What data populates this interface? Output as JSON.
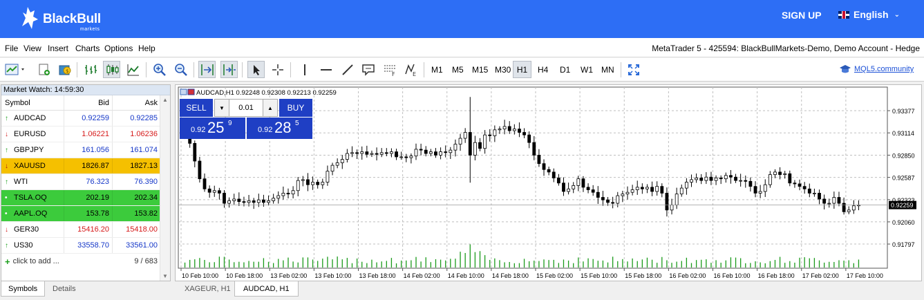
{
  "brand": {
    "name": "BlackBull",
    "sub": "markets",
    "signup": "SIGN UP",
    "language": "English"
  },
  "menu": [
    "File",
    "View",
    "Insert",
    "Charts",
    "Options",
    "Help"
  ],
  "account": "MetaTrader 5 - 425594: BlackBullMarkets-Demo, Demo Account - Hedge",
  "timeframes": [
    "M1",
    "M5",
    "M15",
    "M30",
    "H1",
    "H4",
    "D1",
    "W1",
    "MN"
  ],
  "active_timeframe": "H1",
  "mql5": "MQL5.community",
  "market_watch": {
    "title": "Market Watch: 14:59:30",
    "headers": {
      "symbol": "Symbol",
      "bid": "Bid",
      "ask": "Ask"
    },
    "rows": [
      {
        "symbol": "AUDCAD",
        "bid": "0.92259",
        "ask": "0.92285",
        "dir": "up",
        "style": "blue"
      },
      {
        "symbol": "EURUSD",
        "bid": "1.06221",
        "ask": "1.06236",
        "dir": "down",
        "style": "red"
      },
      {
        "symbol": "GBPJPY",
        "bid": "161.056",
        "ask": "161.074",
        "dir": "up",
        "style": "blue"
      },
      {
        "symbol": "XAUUSD",
        "bid": "1826.87",
        "ask": "1827.13",
        "dir": "down",
        "style": "gold"
      },
      {
        "symbol": "WTI",
        "bid": "76.323",
        "ask": "76.390",
        "dir": "up",
        "style": "blue"
      },
      {
        "symbol": "TSLA.OQ",
        "bid": "202.19",
        "ask": "202.34",
        "dir": "dot",
        "style": "green"
      },
      {
        "symbol": "AAPL.OQ",
        "bid": "153.78",
        "ask": "153.82",
        "dir": "dot",
        "style": "green"
      },
      {
        "symbol": "GER30",
        "bid": "15416.20",
        "ask": "15418.00",
        "dir": "down",
        "style": "red"
      },
      {
        "symbol": "US30",
        "bid": "33558.70",
        "ask": "33561.00",
        "dir": "up",
        "style": "blue"
      }
    ],
    "add_label": "click to add ...",
    "count": "9 / 683",
    "tabs": [
      "Symbols",
      "Details"
    ]
  },
  "chart": {
    "header": "AUDCAD,H1  0.92248 0.92308 0.92213 0.92259",
    "trade": {
      "sell": "SELL",
      "buy": "BUY",
      "lot": "0.01",
      "sell_small": "0.92",
      "sell_big": "25",
      "sell_sup": "9",
      "buy_small": "0.92",
      "buy_big": "28",
      "buy_sup": "5"
    },
    "current_price": "0.92259",
    "price_ticks": [
      "0.93377",
      "0.93114",
      "0.92850",
      "0.92587",
      "0.92323",
      "0.92060",
      "0.91797"
    ],
    "time_ticks": [
      "10 Feb 10:00",
      "10 Feb 18:00",
      "13 Feb 02:00",
      "13 Feb 10:00",
      "13 Feb 18:00",
      "14 Feb 02:00",
      "14 Feb 10:00",
      "14 Feb 18:00",
      "15 Feb 02:00",
      "15 Feb 10:00",
      "15 Feb 18:00",
      "16 Feb 02:00",
      "16 Feb 10:00",
      "16 Feb 18:00",
      "17 Feb 02:00",
      "17 Feb 10:00"
    ],
    "tabs": [
      "XAGEUR, H1",
      "AUDCAD, H1"
    ],
    "active_tab": "AUDCAD, H1"
  },
  "chart_data": {
    "type": "candlestick",
    "symbol": "AUDCAD",
    "timeframe": "H1",
    "ylim": [
      0.9165,
      0.9355
    ],
    "close": [
      0.931,
      0.9299,
      0.9278,
      0.9257,
      0.9245,
      0.9241,
      0.9243,
      0.924,
      0.9228,
      0.9231,
      0.9233,
      0.923,
      0.9229,
      0.9231,
      0.9229,
      0.9232,
      0.9229,
      0.9231,
      0.9234,
      0.9237,
      0.924,
      0.9239,
      0.9243,
      0.9255,
      0.9256,
      0.925,
      0.9253,
      0.925,
      0.9253,
      0.9266,
      0.9273,
      0.9276,
      0.928,
      0.9287,
      0.9288,
      0.9287,
      0.9289,
      0.9286,
      0.9287,
      0.9286,
      0.9288,
      0.9287,
      0.9289,
      0.9283,
      0.9283,
      0.9282,
      0.9284,
      0.9292,
      0.9291,
      0.9287,
      0.9289,
      0.9285,
      0.9289,
      0.9288,
      0.9291,
      0.9298,
      0.9305,
      0.9312,
      0.9285,
      0.93,
      0.9293,
      0.9309,
      0.9308,
      0.9315,
      0.9316,
      0.9319,
      0.9314,
      0.9316,
      0.9312,
      0.9309,
      0.93,
      0.9285,
      0.9275,
      0.9268,
      0.9265,
      0.9258,
      0.9252,
      0.9242,
      0.9245,
      0.9249,
      0.9257,
      0.9247,
      0.9244,
      0.9241,
      0.9235,
      0.9232,
      0.9229,
      0.9228,
      0.9237,
      0.9239,
      0.9241,
      0.9244,
      0.9247,
      0.9245,
      0.9247,
      0.9242,
      0.9248,
      0.924,
      0.922,
      0.9226,
      0.9239,
      0.9246,
      0.9253,
      0.9256,
      0.9258,
      0.9255,
      0.9259,
      0.9255,
      0.9258,
      0.9257,
      0.9261,
      0.9259,
      0.9255,
      0.9255,
      0.9254,
      0.9248,
      0.924,
      0.9242,
      0.925,
      0.9262,
      0.9265,
      0.9262,
      0.9263,
      0.9252,
      0.9251,
      0.9248,
      0.9245,
      0.924,
      0.924,
      0.9233,
      0.9228,
      0.9228,
      0.9235,
      0.9228,
      0.9218,
      0.922,
      0.9225,
      0.9226
    ],
    "volume_note": "relative tick volume bars along bottom"
  }
}
